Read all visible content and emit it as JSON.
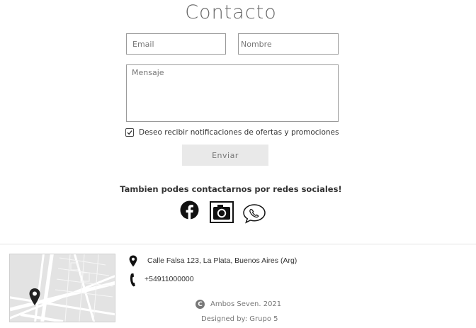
{
  "form": {
    "title": "Contacto",
    "email_placeholder": "Email",
    "nombre_placeholder": "Nombre",
    "mensaje_placeholder": "Mensaje",
    "checkbox_label": "Deseo recibir notificaciones de ofertas y promociones",
    "checkbox_checked": true,
    "submit_label": "Enviar"
  },
  "social": {
    "heading": "Tambien podes contactarnos por redes sociales!",
    "icons": [
      "facebook-icon",
      "camera-icon",
      "whatsapp-icon"
    ]
  },
  "footer": {
    "address": "Calle Falsa 123, La Plata, Buenos Aires (Arg)",
    "phone": "+54911000000",
    "copyright": "Ambos Seven. 2021",
    "copyright_icon": "C",
    "designed_by": "Designed by: Grupo 5"
  },
  "colors": {
    "button_bg": "#e9e9e9",
    "map_bg": "#e3e3e3"
  }
}
